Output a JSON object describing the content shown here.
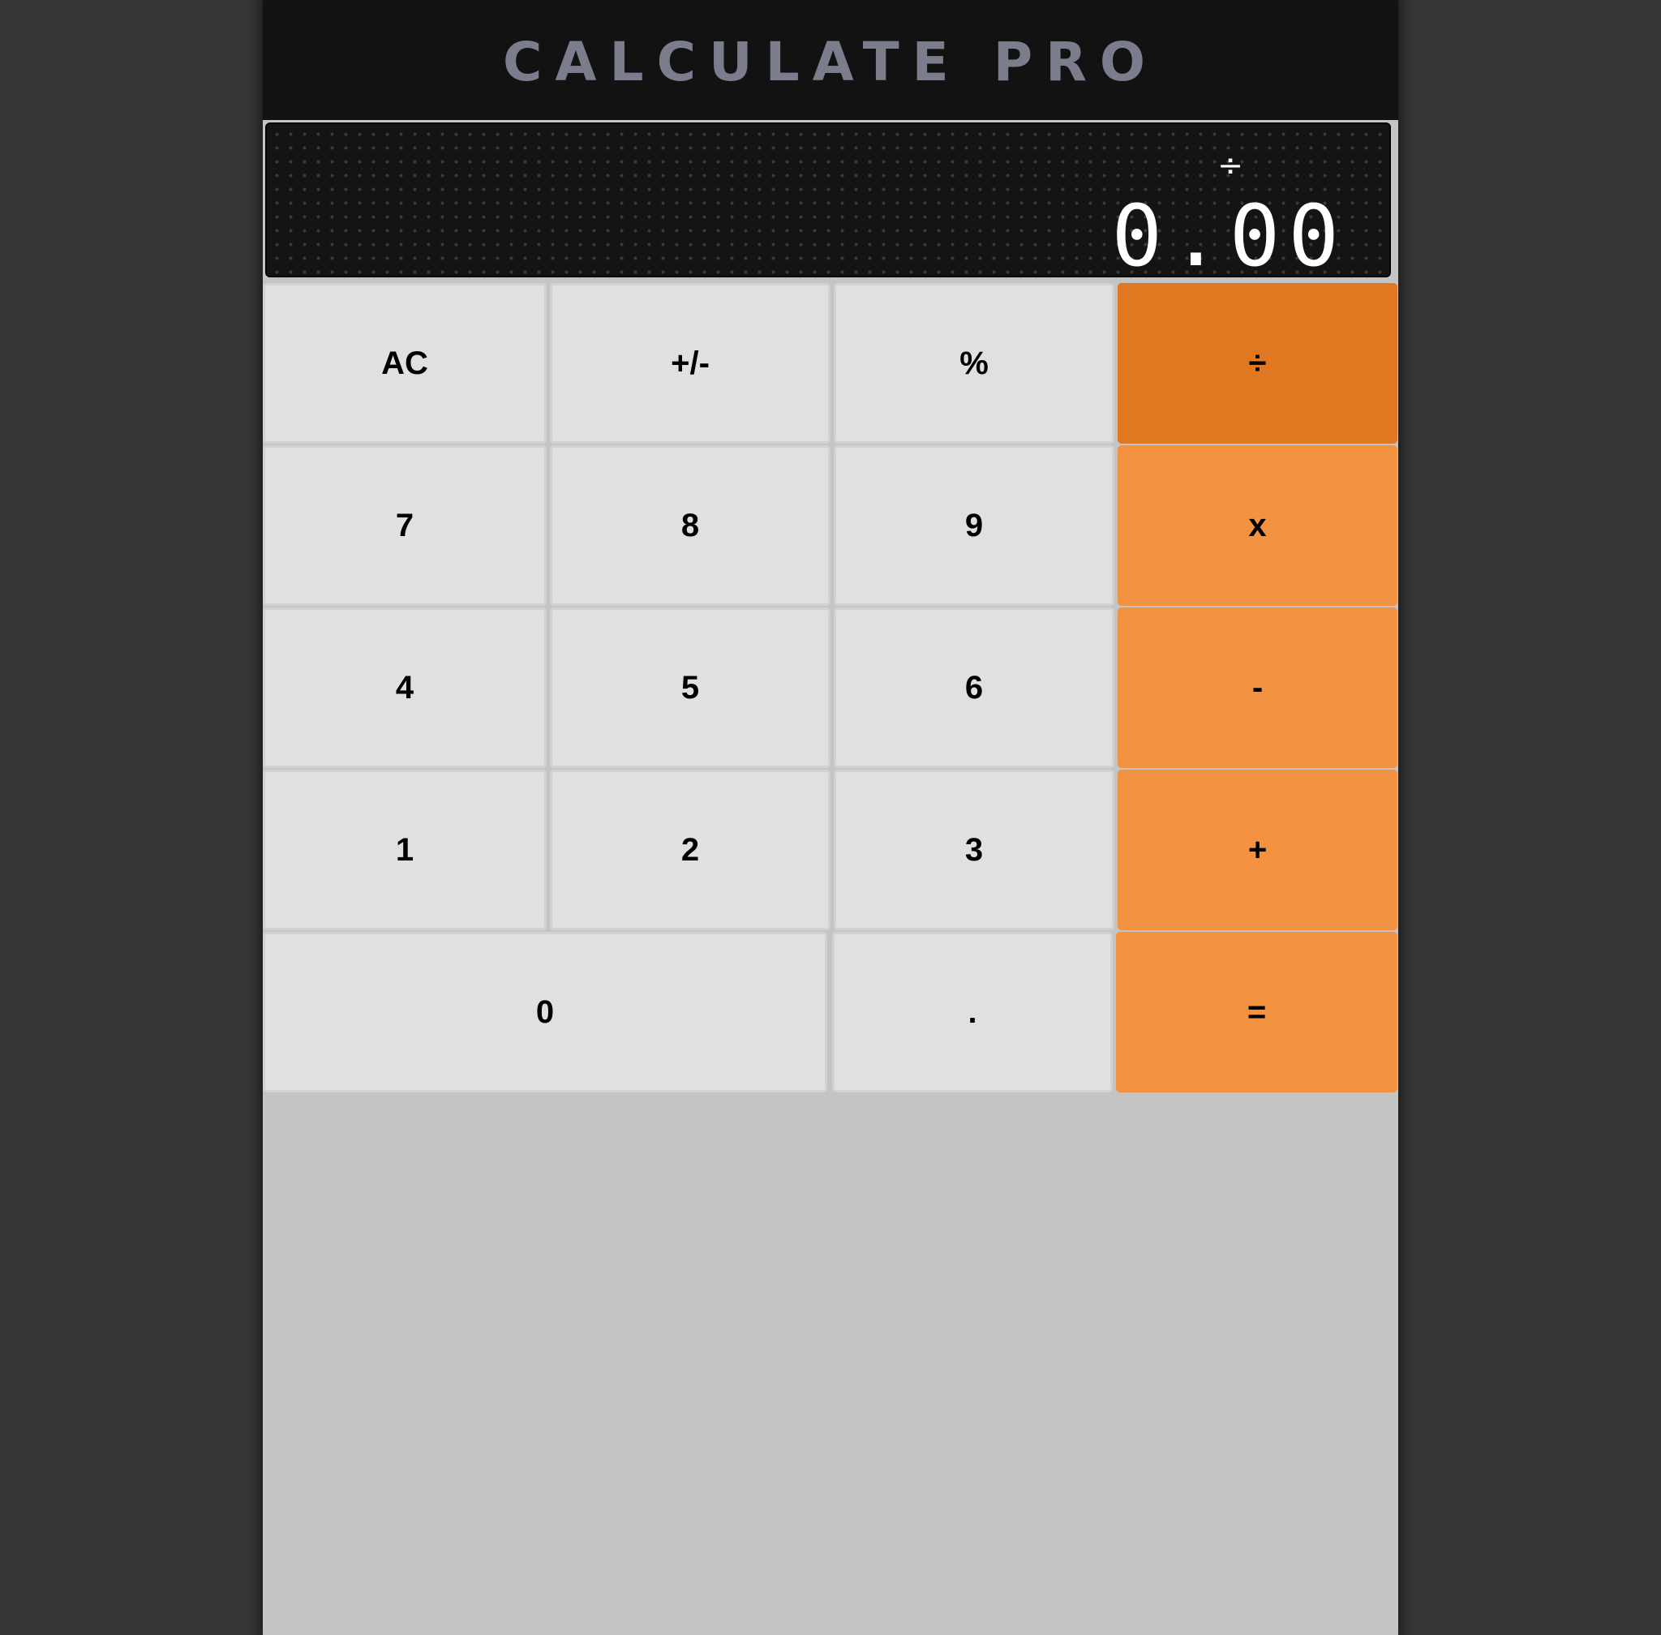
{
  "app": {
    "title": "CALCULATE PRO"
  },
  "display": {
    "operator": "÷",
    "value": "0.00"
  },
  "keys": {
    "ac": "AC",
    "sign": "+/-",
    "percent": "%",
    "divide": "÷",
    "seven": "7",
    "eight": "8",
    "nine": "9",
    "multiply": "x",
    "four": "4",
    "five": "5",
    "six": "6",
    "subtract": "-",
    "one": "1",
    "two": "2",
    "three": "3",
    "add": "+",
    "zero": "0",
    "decimal": ".",
    "equals": "="
  },
  "colors": {
    "operator_key": "#f39241",
    "active_operator_key": "#e07721",
    "number_key": "#e0e0e0",
    "header": "#121212",
    "title_text": "#7b7d8c"
  },
  "state": {
    "active_operator": "divide"
  }
}
